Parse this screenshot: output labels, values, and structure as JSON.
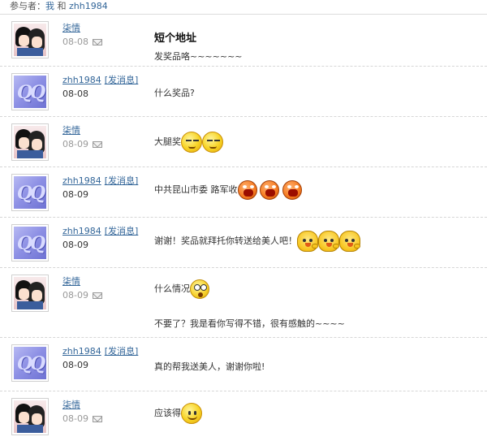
{
  "header": {
    "prefix": "参与者：",
    "participant_me": "我",
    "joiner": "和",
    "participant_other": "zhh1984"
  },
  "send_label": "[发消息]",
  "messages": [
    {
      "author": "柒情",
      "date": "08-08",
      "avatar": "anime-couple",
      "title": "短个地址",
      "text": "发奖品咯~~~~~~~"
    },
    {
      "author": "zhh1984",
      "date": "08-08",
      "avatar": "qq-default",
      "text": "什么奖品?"
    },
    {
      "author": "柒情",
      "date": "08-09",
      "avatar": "anime-couple",
      "text": "大腿奖",
      "emoji": [
        "sleepy-smile",
        "sleepy-smile"
      ]
    },
    {
      "author": "zhh1984",
      "date": "08-09",
      "avatar": "qq-default",
      "text": "中共昆山市委 路军收",
      "emoji": [
        "angry-face",
        "angry-face",
        "angry-face"
      ]
    },
    {
      "author": "zhh1984",
      "date": "08-09",
      "avatar": "qq-default",
      "text": "谢谢！奖品就拜托你转送给美人吧！",
      "emoji": [
        "chick",
        "chick",
        "chick"
      ]
    },
    {
      "author": "柒情",
      "date": "08-09",
      "avatar": "anime-couple",
      "text": "什么情况",
      "text2": "不要了？我是看你写得不错，很有感触的~~~~",
      "emoji": [
        "shocked-face"
      ]
    },
    {
      "author": "zhh1984",
      "date": "08-09",
      "avatar": "qq-default",
      "text": "真的帮我送美人，谢谢你啦!"
    },
    {
      "author": "柒情",
      "date": "08-09",
      "avatar": "anime-couple",
      "text": "应该得",
      "emoji": [
        "happy-face"
      ]
    }
  ]
}
